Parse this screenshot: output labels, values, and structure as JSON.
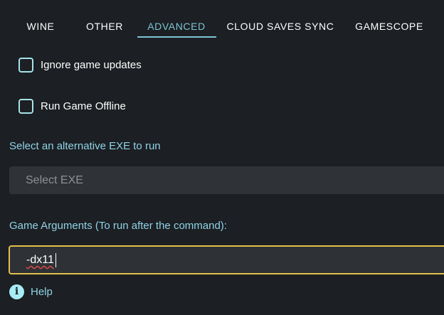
{
  "tabs": [
    {
      "label": "WINE"
    },
    {
      "label": "OTHER"
    },
    {
      "label": "ADVANCED",
      "active": true
    },
    {
      "label": "CLOUD SAVES SYNC"
    },
    {
      "label": "GAMESCOPE"
    }
  ],
  "options": {
    "ignore_updates": {
      "label": "Ignore game updates",
      "checked": false
    },
    "run_offline": {
      "label": "Run Game Offline",
      "checked": false
    }
  },
  "exe": {
    "label": "Select an alternative EXE to run",
    "placeholder": "Select EXE"
  },
  "arguments": {
    "label": "Game Arguments (To run after the command):",
    "value": "-dx11"
  },
  "help": {
    "label": "Help",
    "icon": "info-icon"
  },
  "colors": {
    "background": "#1c1f23",
    "accent": "#7cc4d4",
    "focus_border": "#e2c04b",
    "checkbox_border": "#a6e3ea"
  }
}
